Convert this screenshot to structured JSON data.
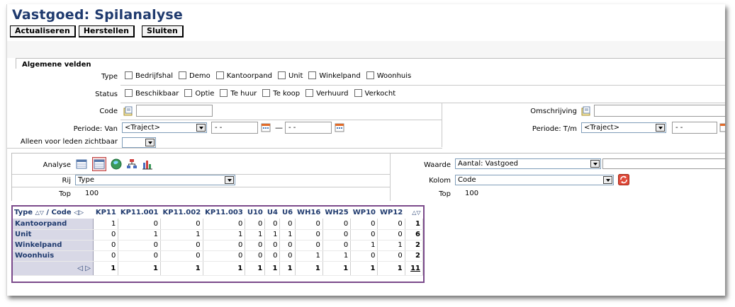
{
  "title": "Vastgoed: Spilanalyse",
  "toolbar": {
    "refresh": "Actualiseren",
    "restore": "Herstellen",
    "close": "Sluiten"
  },
  "section_title": "Algemene velden",
  "type_label": "Type",
  "type_options": [
    "Bedrijfshal",
    "Demo",
    "Kantoorpand",
    "Unit",
    "Winkelpand",
    "Woonhuis"
  ],
  "status_label": "Status",
  "status_options": [
    "Beschikbaar",
    "Optie",
    "Te huur",
    "Te koop",
    "Verhuurd",
    "Verkocht"
  ],
  "code_label": "Code",
  "description_label": "Omschrijving",
  "period_from_label": "Periode: Van",
  "period_from_select": "<Traject>",
  "period_from_date": "- -",
  "period_sep": "—",
  "period_from_date2": "- -",
  "period_to_label": "Periode: T/m",
  "period_to_select": "<Traject>",
  "period_to_date": "- -",
  "members_only_label": "Alleen voor leden zichtbaar",
  "analysis_label": "Analyse",
  "row_label": "Rij",
  "row_value": "Type",
  "top_label": "Top",
  "top_value": "100",
  "value_label": "Waarde",
  "value_value": "Aantal: Vastgoed",
  "column_label": "Kolom",
  "column_value": "Code",
  "top2_label": "Top",
  "top2_value": "100",
  "pivot": {
    "corner_row": "Type",
    "corner_col": "/ Code",
    "columns": [
      "KP11",
      "KP11.001",
      "KP11.002",
      "KP11.003",
      "U10",
      "U4",
      "U6",
      "WH16",
      "WH25",
      "WP10",
      "WP12"
    ],
    "rows": [
      {
        "label": "Kantoorpand",
        "values": [
          "1",
          "0",
          "0",
          "0",
          "0",
          "0",
          "0",
          "0",
          "0",
          "0",
          "0"
        ],
        "total": "1"
      },
      {
        "label": "Unit",
        "values": [
          "0",
          "1",
          "1",
          "1",
          "1",
          "1",
          "1",
          "0",
          "0",
          "0",
          "0"
        ],
        "total": "6"
      },
      {
        "label": "Winkelpand",
        "values": [
          "0",
          "0",
          "0",
          "0",
          "0",
          "0",
          "0",
          "0",
          "0",
          "1",
          "1"
        ],
        "total": "2"
      },
      {
        "label": "Woonhuis",
        "values": [
          "0",
          "0",
          "0",
          "0",
          "0",
          "0",
          "0",
          "1",
          "1",
          "0",
          "0"
        ],
        "total": "2"
      }
    ],
    "totals": [
      "1",
      "1",
      "1",
      "1",
      "1",
      "1",
      "1",
      "1",
      "1",
      "1",
      "1"
    ],
    "grand_total": "11"
  },
  "colors": {
    "title": "#1f3a6e",
    "pivot_border": "#7b4a8b",
    "row_header_bg": "#d8d8e6"
  }
}
